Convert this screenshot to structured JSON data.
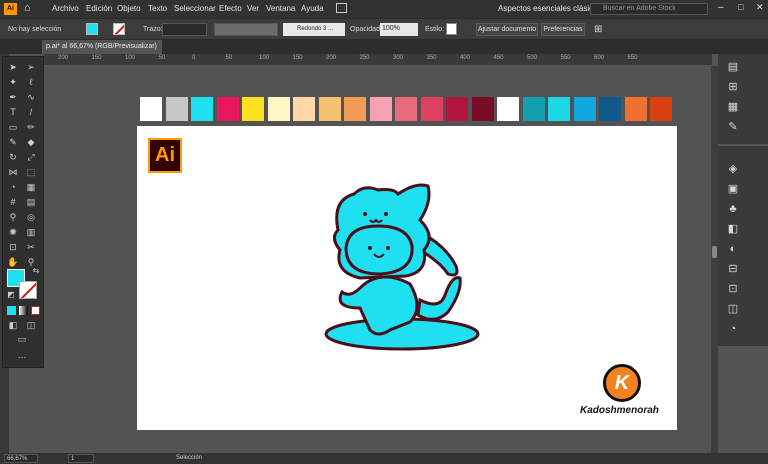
{
  "menubar": {
    "items": [
      "Archivo",
      "Edición",
      "Objeto",
      "Texto",
      "Seleccionar",
      "Efecto",
      "Ver",
      "Ventana",
      "Ayuda"
    ],
    "workspace": "Aspectos esenciales clásicos",
    "search_placeholder": "Buscar en Adobe Stock"
  },
  "control": {
    "selection": "No hay selección",
    "stroke_label": "Trazo:",
    "brush": "Redondo 3 ...",
    "opacity_label": "Opacidad:",
    "opacity": "100%",
    "style_label": "Estilo:",
    "adjust": "Ajustar documento",
    "prefs": "Preferencias"
  },
  "doc": {
    "tab": "p.ai* al 66,67% (RGB/Previsualizar)"
  },
  "ruler": {
    "h": [
      "200",
      "150",
      "100",
      "50",
      "0",
      "50",
      "100",
      "150",
      "200",
      "250",
      "300",
      "350",
      "400",
      "450",
      "500",
      "550",
      "600",
      "650"
    ]
  },
  "swatches": [
    "#ffffff",
    "#c8c8c8",
    "#1ee0f0",
    "#e8175d",
    "#fbe021",
    "#fff6c8",
    "#ffd6a8",
    "#f7c26f",
    "#f39c55",
    "#f5a0b3",
    "#e96a7c",
    "#e04060",
    "#b01640",
    "#7a0c28",
    "#ffffff",
    "#12a0b0",
    "#1ed8e6",
    "#14a8e0",
    "#0f5a8a",
    "#f07030",
    "#d8400f"
  ],
  "logos": {
    "ai": "Ai",
    "k": "K",
    "brand": "Kadoshmenorah"
  },
  "status": {
    "zoom": "66,67%",
    "page": "1",
    "tool": "Selección"
  },
  "colors": {
    "accent": "#1ee0f0"
  }
}
